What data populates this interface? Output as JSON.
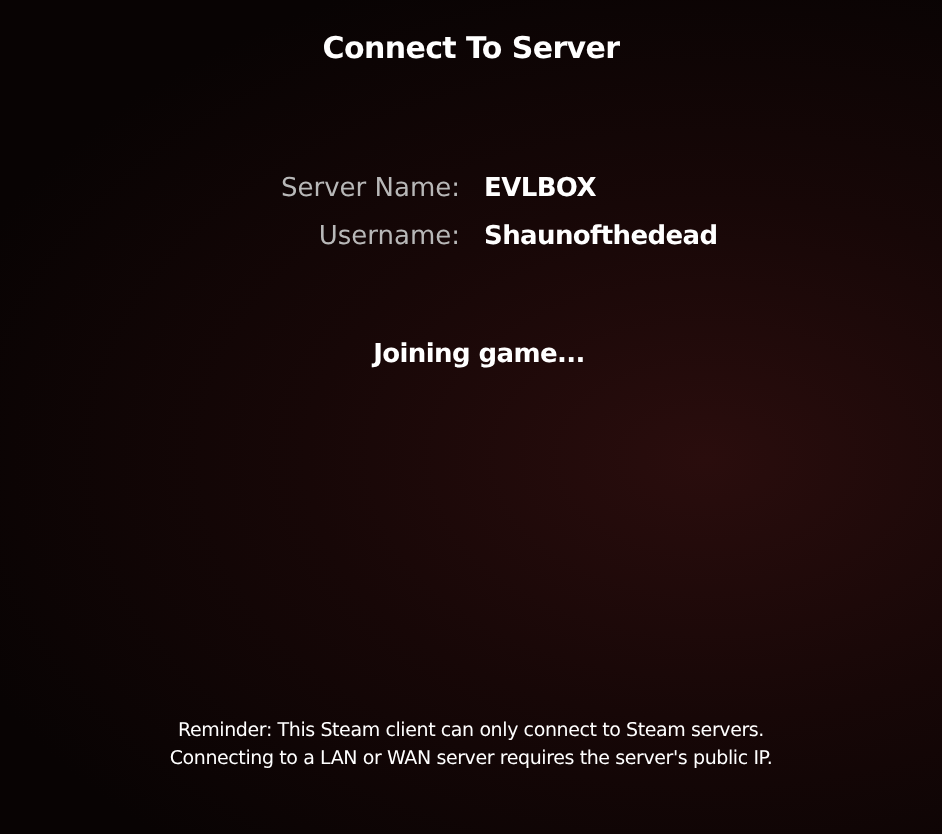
{
  "dialog": {
    "title": "Connect To Server"
  },
  "fields": [
    {
      "label": "Server Name:",
      "value": "EVLBOX"
    },
    {
      "label": "Username:",
      "value": "Shaunofthedead"
    }
  ],
  "status": "Joining game...",
  "reminder": [
    "Reminder: This Steam client can only connect to Steam servers.",
    "Connecting to a LAN or WAN server requires the server's public IP."
  ]
}
